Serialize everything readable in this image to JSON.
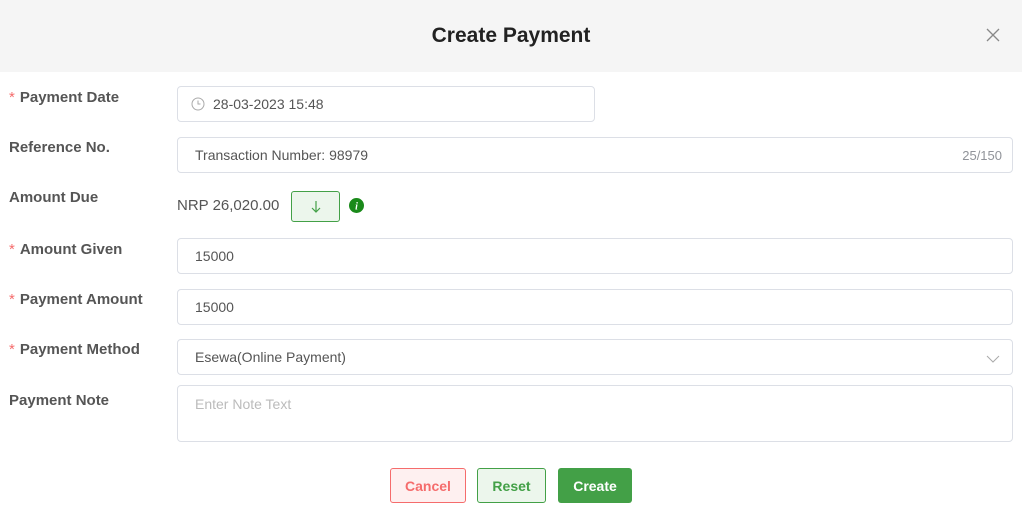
{
  "dialog": {
    "title": "Create Payment"
  },
  "form": {
    "payment_date": {
      "label": "Payment Date",
      "value": "28-03-2023 15:48",
      "required": true
    },
    "reference_no": {
      "label": "Reference No.",
      "value": "Transaction Number: 98979",
      "counter": "25/150"
    },
    "amount_due": {
      "label": "Amount Due",
      "value": "NRP 26,020.00"
    },
    "amount_given": {
      "label": "Amount Given",
      "value": "15000",
      "required": true
    },
    "payment_amount": {
      "label": "Payment Amount",
      "value": "15000",
      "required": true
    },
    "payment_method": {
      "label": "Payment Method",
      "value": "Esewa(Online Payment)",
      "required": true
    },
    "payment_note": {
      "label": "Payment Note",
      "placeholder": "Enter Note Text"
    }
  },
  "buttons": {
    "cancel": "Cancel",
    "reset": "Reset",
    "create": "Create"
  },
  "colors": {
    "primary": "#43a047",
    "danger": "#f56c6c",
    "info": "#1a8a1a"
  }
}
